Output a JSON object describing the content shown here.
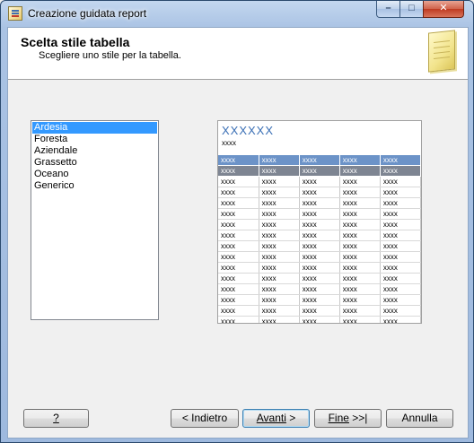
{
  "window": {
    "title": "Creazione guidata report",
    "controls": {
      "minimize": "–",
      "maximize": "□",
      "close": "✕"
    }
  },
  "header": {
    "title": "Scelta stile tabella",
    "subtitle": "Scegliere uno stile per la tabella."
  },
  "styles": {
    "items": [
      "Ardesia",
      "Foresta",
      "Aziendale",
      "Grassetto",
      "Oceano",
      "Generico"
    ],
    "selected": "Ardesia"
  },
  "preview": {
    "title": "XXXXXX",
    "subtitle": "xxxx",
    "cell_text": "xxxx",
    "columns": 5,
    "header_rows": 2,
    "body_rows": 16,
    "colors": {
      "title": "#3a6fb5",
      "header_row_1": "#6c93c8",
      "header_row_2": "#7e8592"
    }
  },
  "buttons": {
    "help": "?",
    "back": "< Indietro",
    "next_main": "Avanti",
    "next_arrow": " >",
    "finish_main": "Fine",
    "finish_arrow": " >>|",
    "cancel": "Annulla"
  },
  "colors": {
    "selection": "#3399ff",
    "window_frame": "#aac3e4"
  }
}
